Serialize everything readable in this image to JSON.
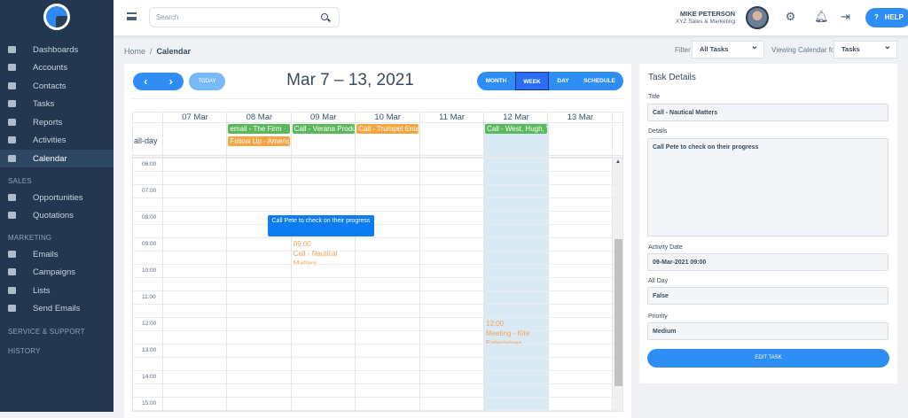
{
  "sidebar": {
    "items": [
      "Dashboards",
      "Accounts",
      "Contacts",
      "Tasks",
      "Reports",
      "Activities",
      "Calendar"
    ],
    "sales": {
      "title": "SALES",
      "items": [
        "Opportunities",
        "Quotations"
      ]
    },
    "marketing": {
      "title": "MARKETING",
      "items": [
        "Emails",
        "Campaigns",
        "Lists",
        "Send Emails"
      ]
    },
    "service": "SERVICE & SUPPORT",
    "history": "HISTORY"
  },
  "header": {
    "search_placeholder": "Search",
    "user_name": "MIKE PETERSON",
    "user_role": "XYZ Sales & Marketing",
    "help": "HELP"
  },
  "breadcrumb": {
    "home": "Home",
    "current": "Calendar"
  },
  "filters": {
    "filter_label": "Filter",
    "filter_value": "All Tasks",
    "viewing_label": "Viewing Calendar for:",
    "viewing_value": "Tasks"
  },
  "calendar": {
    "today": "TODAY",
    "title": "Mar 7 – 13, 2021",
    "views": [
      "MONTH",
      "WEEK",
      "DAY",
      "SCHEDULE"
    ],
    "days": [
      "07 Mar",
      "08 Mar",
      "09 Mar",
      "10 Mar",
      "11 Mar",
      "12 Mar",
      "13 Mar"
    ],
    "allday_label": "all-day",
    "allday_events": [
      {
        "day": 1,
        "row": 0,
        "title": "email - The Firm",
        "color": "#5cb85c"
      },
      {
        "day": 1,
        "row": 1,
        "title": "Follow Up - American",
        "color": "#f7a541"
      },
      {
        "day": 2,
        "row": 0,
        "title": "Call - Verana Products",
        "color": "#5cb85c"
      },
      {
        "day": 3,
        "row": 0,
        "title": "Call - Trumpet Enterprises",
        "color": "#f7a541"
      },
      {
        "day": 5,
        "row": 0,
        "title": "Call - West, Hugh, Vance",
        "color": "#5cb85c"
      }
    ],
    "times": [
      "06:00",
      "07:00",
      "08:00",
      "09:00",
      "10:00",
      "11:00",
      "12:00",
      "13:00",
      "14:00",
      "15:00"
    ],
    "events": [
      {
        "day": 2,
        "time": "09:00",
        "title": "Call - Nautical Matters"
      },
      {
        "day": 5,
        "time": "12:00",
        "title": "Meeting - Kite Enterprises"
      }
    ],
    "tooltip": "Call Pete to check on their progress"
  },
  "details": {
    "heading": "Task Details",
    "title_label": "Title",
    "title_value": "Call - Nautical Matters",
    "details_label": "Details",
    "details_value": "Call Pete to check on their progress",
    "date_label": "Activity Date",
    "date_value": "09-Mar-2021 09:00",
    "allday_label": "All Day",
    "allday_value": "False",
    "priority_label": "Priority",
    "priority_value": "Medium",
    "edit": "EDIT TASK"
  }
}
